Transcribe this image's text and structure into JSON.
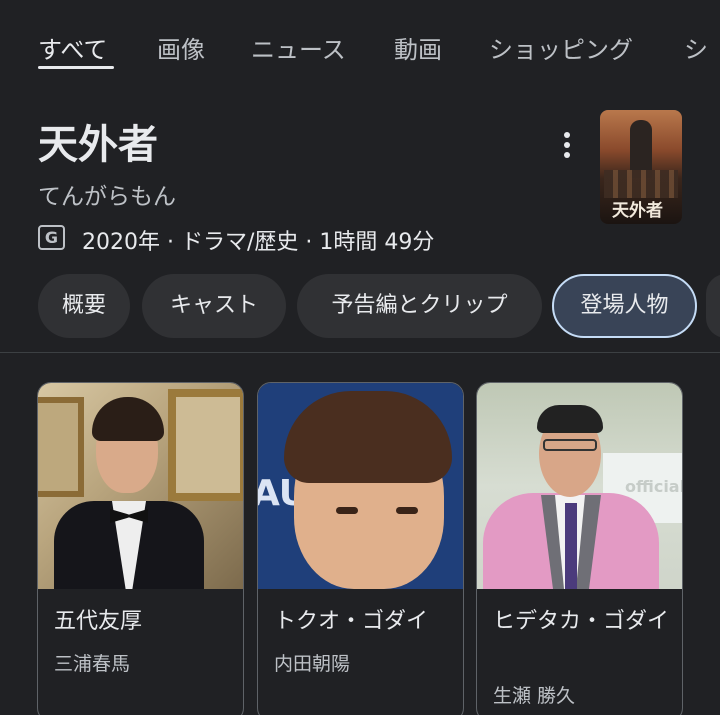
{
  "tabs": [
    {
      "label": "すべて",
      "active": true
    },
    {
      "label": "画像",
      "active": false
    },
    {
      "label": "ニュース",
      "active": false
    },
    {
      "label": "動画",
      "active": false
    },
    {
      "label": "ショッピング",
      "active": false
    },
    {
      "label": "シ",
      "active": false
    }
  ],
  "panel": {
    "title": "天外者",
    "subtitle": "てんがらもん",
    "rating": "G",
    "meta": "2020年 · ドラマ/歴史 · 1時間 49分",
    "more_icon": "more-vert-icon",
    "poster_text": "天外者"
  },
  "chips": [
    {
      "label": "概要",
      "selected": false
    },
    {
      "label": "キャスト",
      "selected": false
    },
    {
      "label": "予告編とクリップ",
      "selected": false
    },
    {
      "label": "登場人物",
      "selected": true
    }
  ],
  "cast": [
    {
      "character": "五代友厚",
      "actor": "三浦春馬"
    },
    {
      "character": "トクオ・ゴダイ",
      "actor": "内田朝陽"
    },
    {
      "character": "ヒデタカ・ゴダイ",
      "actor": "生瀬 勝久"
    }
  ],
  "photo_text": {
    "logo": "AU",
    "sign": "official"
  },
  "colors": {
    "background": "#202124",
    "chip": "#303134",
    "chip_selected": "#394457",
    "chip_selected_border": "#c5dcf6",
    "text_primary": "#e8eaed",
    "text_secondary": "#bdc1c6"
  }
}
